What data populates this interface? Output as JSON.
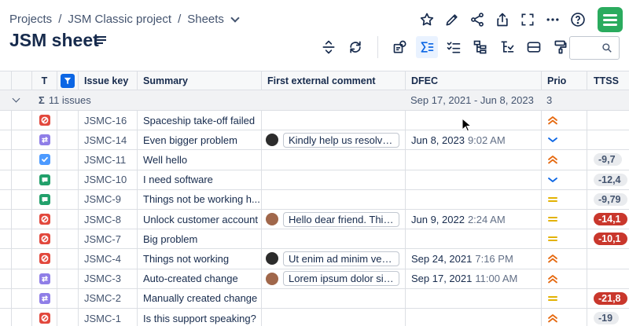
{
  "breadcrumb": {
    "projects": "Projects",
    "project": "JSM Classic project",
    "sheets": "Sheets",
    "sep": "/"
  },
  "page_title": "JSM sheet",
  "columns": {
    "t": "T",
    "key": "Issue key",
    "summary": "Summary",
    "comment": "First external comment",
    "dfec": "DFEC",
    "prio": "Prio",
    "ttss": "TTSS"
  },
  "group": {
    "sigma": "Σ",
    "count": "11 issues",
    "dfec_range": "Sep 17, 2021 - Jun 8, 2023",
    "prio_count": "3"
  },
  "rows": [
    {
      "type": "red",
      "key": "JSMC-16",
      "summary": "Spaceship take-off failed",
      "comment": "",
      "avatar": "",
      "date": "",
      "time": "",
      "prio": "highest",
      "ttss": ""
    },
    {
      "type": "purple",
      "key": "JSMC-14",
      "summary": "Even bigger problem",
      "comment": "Kindly help us resolve t...",
      "avatar": "dark",
      "date": "Jun 8, 2023",
      "time": "9:02 AM",
      "prio": "lowest",
      "ttss": ""
    },
    {
      "type": "blue",
      "key": "JSMC-11",
      "summary": "Well hello",
      "comment": "",
      "avatar": "",
      "date": "",
      "time": "",
      "prio": "highest",
      "ttss": "-9,7",
      "ttss_style": "grey"
    },
    {
      "type": "green",
      "key": "JSMC-10",
      "summary": "I need software",
      "comment": "",
      "avatar": "",
      "date": "",
      "time": "",
      "prio": "lowest",
      "ttss": "-12,4",
      "ttss_style": "grey"
    },
    {
      "type": "green",
      "key": "JSMC-9",
      "summary": "Things not be working h...",
      "comment": "",
      "avatar": "",
      "date": "",
      "time": "",
      "prio": "medium",
      "ttss": "-9,79",
      "ttss_style": "grey"
    },
    {
      "type": "red",
      "key": "JSMC-8",
      "summary": "Unlock customer account",
      "comment": "Hello dear friend. This i...",
      "avatar": "brown",
      "date": "Jun 9, 2022",
      "time": "2:24 AM",
      "prio": "medium",
      "ttss": "-14,1",
      "ttss_style": "red"
    },
    {
      "type": "red",
      "key": "JSMC-7",
      "summary": "Big problem",
      "comment": "",
      "avatar": "",
      "date": "",
      "time": "",
      "prio": "medium",
      "ttss": "-10,1",
      "ttss_style": "red"
    },
    {
      "type": "red",
      "key": "JSMC-4",
      "summary": "Things not working",
      "comment": "Ut enim ad minim venia...",
      "avatar": "dark",
      "date": "Sep 24, 2021",
      "time": "7:16 PM",
      "prio": "highest",
      "ttss": ""
    },
    {
      "type": "purple",
      "key": "JSMC-3",
      "summary": "Auto-created change",
      "comment": "Lorem ipsum dolor sit a...",
      "avatar": "brown",
      "date": "Sep 17, 2021",
      "time": "11:00 AM",
      "prio": "highest",
      "ttss": ""
    },
    {
      "type": "purple",
      "key": "JSMC-2",
      "summary": "Manually created change",
      "comment": "",
      "avatar": "",
      "date": "",
      "time": "",
      "prio": "medium",
      "ttss": "-21,8",
      "ttss_style": "red"
    },
    {
      "type": "red",
      "key": "JSMC-1",
      "summary": "Is this support speaking?",
      "comment": "",
      "avatar": "",
      "date": "",
      "time": "",
      "prio": "highest",
      "ttss": "-19",
      "ttss_style": "grey"
    }
  ],
  "colors": {
    "accent": "#0c66e4",
    "app": "#2aab5e",
    "prio_high": "#e56910",
    "prio_low": "#0c66e4",
    "prio_medium": "#e2b203",
    "ttss_red": "#c9372c"
  },
  "icons": {
    "top": [
      "star-icon",
      "pencil-icon",
      "share-icon",
      "export-icon",
      "fullscreen-icon",
      "more-icon",
      "help-icon",
      "app-icon"
    ],
    "toolbar": [
      "row-height-icon",
      "refresh-icon",
      "issue-view-icon",
      "sum-icon",
      "checklist-icon",
      "hierarchy-icon",
      "sort-hierarchy-icon",
      "grouping-icon",
      "format-paint-icon"
    ]
  }
}
